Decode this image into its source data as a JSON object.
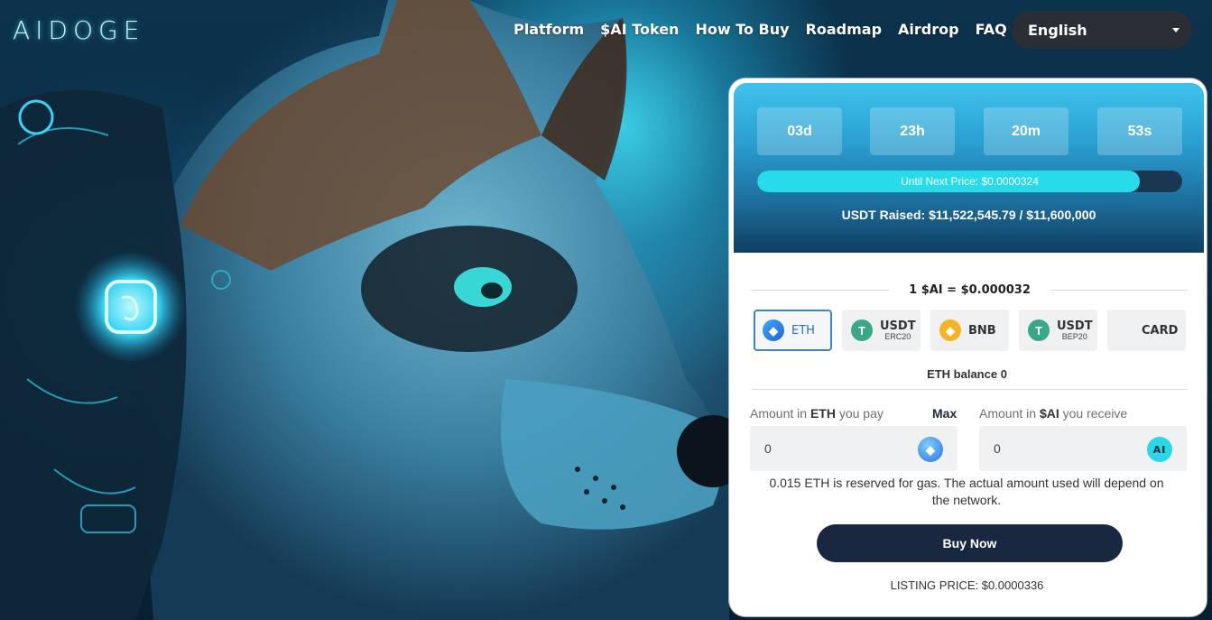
{
  "brand": {
    "logo_text": "AIDOGE"
  },
  "nav": {
    "items": [
      {
        "label": "Platform"
      },
      {
        "label": "$AI Token"
      },
      {
        "label": "How To Buy"
      },
      {
        "label": "Roadmap"
      },
      {
        "label": "Airdrop"
      },
      {
        "label": "FAQ"
      }
    ]
  },
  "language": {
    "selected": "English"
  },
  "presale": {
    "timer": {
      "days": "03d",
      "hours": "23h",
      "minutes": "20m",
      "seconds": "53s"
    },
    "progress": {
      "label": "Until Next Price: $0.0000324",
      "fraction": 0.9
    },
    "raised_text": "USDT Raised: $11,522,545.79 / $11,600,000",
    "price_text": "1 $AI = $0.000032",
    "pay_options": [
      {
        "label": "ETH",
        "sub": "",
        "icon": "eth-icon",
        "active": true
      },
      {
        "label": "USDT",
        "sub": "ERC20",
        "icon": "usdt-icon",
        "active": false
      },
      {
        "label": "BNB",
        "sub": "",
        "icon": "bnb-icon",
        "active": false
      },
      {
        "label": "USDT",
        "sub": "BEP20",
        "icon": "usdt-icon",
        "active": false
      },
      {
        "label": "CARD",
        "sub": "",
        "icon": "card-icon",
        "active": false
      }
    ],
    "balance_text": "ETH balance 0",
    "pay_field": {
      "prefix": "Amount in ",
      "unit": "ETH",
      "suffix": " you pay",
      "value": "0",
      "max_label": "Max"
    },
    "receive_field": {
      "prefix": "Amount in ",
      "unit": "$AI",
      "suffix": " you receive",
      "value": "0"
    },
    "gas_note": "0.015 ETH is reserved for gas. The actual amount used will depend on the network.",
    "buy_label": "Buy Now",
    "listing_text": "LISTING PRICE: $0.0000336"
  },
  "colors": {
    "accent_cyan": "#28dbe8",
    "button_navy": "#1a2741",
    "active_border": "#3a86c8"
  }
}
